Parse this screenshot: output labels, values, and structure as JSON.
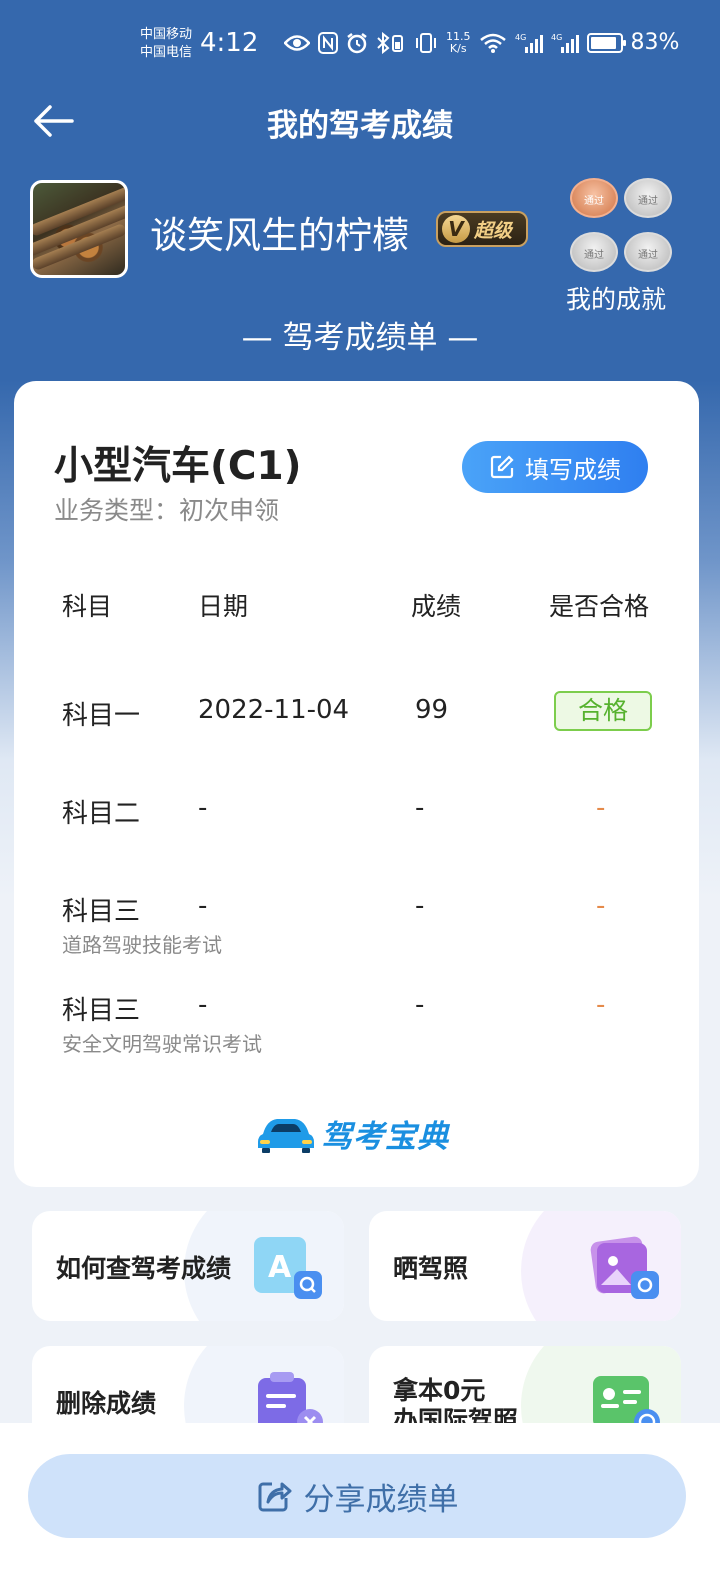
{
  "status_bar": {
    "carrier_1": "中国移动",
    "carrier_2": "中国电信",
    "time": "4:12",
    "net_speed_value": "11.5",
    "net_speed_unit": "K/s",
    "signal_1": "4G",
    "signal_2": "4G",
    "battery_percent": "83%",
    "battery_level": 0.83
  },
  "header": {
    "title": "我的驾考成绩"
  },
  "profile": {
    "username": "谈笑风生的柠檬",
    "vip_badge": "超级",
    "vip_letter": "V",
    "achievements_label": "我的成就",
    "medals": [
      {
        "text": "通过",
        "type": "bronze"
      },
      {
        "text": "通过",
        "type": "silver"
      },
      {
        "text": "通过",
        "type": "silver"
      },
      {
        "text": "通过",
        "type": "silver"
      }
    ]
  },
  "sheet": {
    "title": "— 驾考成绩单 —",
    "car_type": "小型汽车(C1)",
    "business_type": "业务类型：初次申领",
    "fill_button": "填写成绩",
    "columns": [
      "科目",
      "日期",
      "成绩",
      "是否合格"
    ],
    "rows": [
      {
        "subject": "科目一",
        "sub_label": "",
        "date": "2022-11-04",
        "score": "99",
        "result": "合格"
      },
      {
        "subject": "科目二",
        "sub_label": "",
        "date": "-",
        "score": "-",
        "result": "-"
      },
      {
        "subject": "科目三",
        "sub_label": "道路驾驶技能考试",
        "date": "-",
        "score": "-",
        "result": "-"
      },
      {
        "subject": "科目三",
        "sub_label": "安全文明驾驶常识考试",
        "date": "-",
        "score": "-",
        "result": "-"
      }
    ],
    "brand_logo": "驾考宝典"
  },
  "tiles": [
    {
      "label": "如何查驾考成绩",
      "icon": "search-score-icon"
    },
    {
      "label": "晒驾照",
      "icon": "photo-share-icon"
    },
    {
      "label": "删除成绩",
      "icon": "delete-score-icon"
    },
    {
      "label_line1": "拿本0元",
      "label_line2": "办国际驾照",
      "icon": "international-license-icon"
    }
  ],
  "share_button": "分享成绩单",
  "colors": {
    "header_blue": "#3568ad",
    "button_blue": "#2f7ff0",
    "pass_green": "#56b22e",
    "pending_orange": "#e58a4a"
  }
}
